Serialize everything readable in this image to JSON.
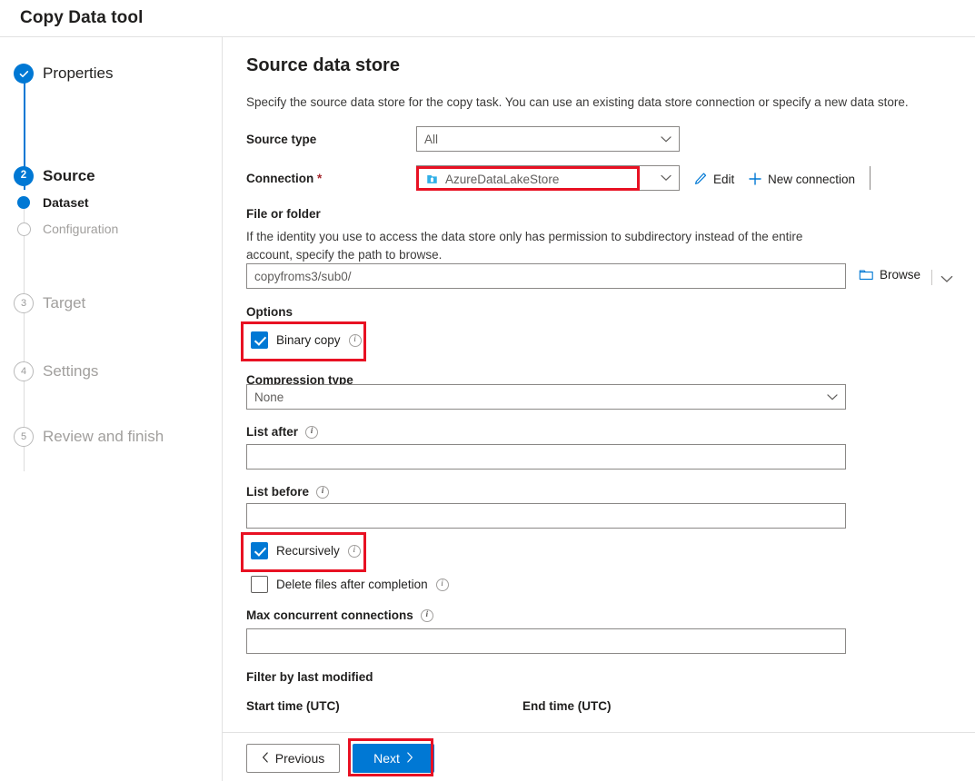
{
  "window": {
    "title": "Copy Data tool"
  },
  "sidebar": {
    "steps": [
      {
        "label": "Properties",
        "marker": "check",
        "state": "completed"
      },
      {
        "label": "Source",
        "marker": "2",
        "state": "current"
      },
      {
        "label": "Dataset",
        "marker": "dot",
        "state": "active-sub"
      },
      {
        "label": "Configuration",
        "marker": "hollow",
        "state": "pending-sub"
      },
      {
        "label": "Target",
        "marker": "3",
        "state": "pending"
      },
      {
        "label": "Settings",
        "marker": "4",
        "state": "pending"
      },
      {
        "label": "Review and finish",
        "marker": "5",
        "state": "pending"
      }
    ]
  },
  "main": {
    "title": "Source data store",
    "description": "Specify the source data store for the copy task. You can use an existing data store connection or specify a new data store.",
    "source_type": {
      "label": "Source type",
      "value": "All"
    },
    "connection": {
      "label": "Connection",
      "required_mark": "*",
      "value": "AzureDataLakeStore",
      "icon": "azure-data-lake-store-icon",
      "edit_label": "Edit",
      "new_connection_label": "New connection"
    },
    "file_or_folder": {
      "label": "File or folder",
      "description": "If the identity you use to access the data store only has permission to subdirectory instead of the entire account, specify the path to browse.",
      "value": "copyfroms3/sub0/",
      "browse_label": "Browse"
    },
    "options": {
      "label": "Options",
      "binary_copy": {
        "label": "Binary copy",
        "checked": true,
        "info": true
      },
      "compression_type": {
        "label": "Compression type",
        "value": "None"
      },
      "list_after": {
        "label": "List after",
        "value": "",
        "info": true
      },
      "list_before": {
        "label": "List before",
        "value": "",
        "info": true
      },
      "recursively": {
        "label": "Recursively",
        "checked": true,
        "info": true
      },
      "delete_files_after_completion": {
        "label": "Delete files after completion",
        "checked": false,
        "info": true
      },
      "max_concurrent_connections": {
        "label": "Max concurrent connections",
        "value": "",
        "info": true
      }
    },
    "filter_by_last_modified": {
      "label": "Filter by last modified",
      "start_time_label": "Start time (UTC)",
      "end_time_label": "End time (UTC)"
    }
  },
  "footer": {
    "previous_label": "Previous",
    "next_label": "Next"
  },
  "colors": {
    "accent": "#0078d4",
    "highlight_box": "#e81123",
    "required": "#a4262c",
    "disabled_text": "#a19f9d"
  }
}
